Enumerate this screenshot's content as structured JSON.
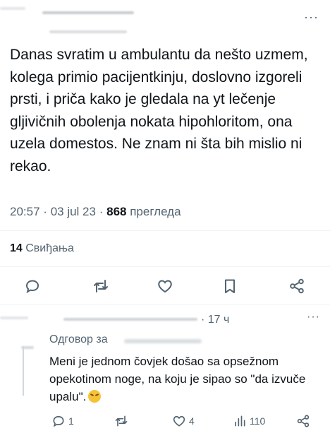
{
  "main_tweet": {
    "text": "Danas svratim u ambulantu da nešto uzmem, kolega primio pacijentkinju, doslovno izgoreli prsti, i priča kako je gledala na yt lečenje gljivičnih obolenja nokata hipohloritom, ona uzela domestos. Ne znam ni šta bih mislio ni rekao.",
    "time": "20:57",
    "date": "03 jul 23",
    "separator": "·",
    "views_count": "868",
    "views_label": "прегледа",
    "likes_count": "14",
    "likes_label": "Свиђања",
    "more_label": "···"
  },
  "actions": {
    "reply": "reply-icon",
    "retweet": "retweet-icon",
    "like": "heart-icon",
    "bookmark": "bookmark-icon",
    "share": "share-icon"
  },
  "reply": {
    "time": "· 17 ч",
    "more_label": "···",
    "replying_to_label": "Одговор за",
    "text": "Meni je jednom čovjek došao sa opsežnom opekotinom noge, na koju je sipao so \"da izvuče upalu\".",
    "reply_count": "1",
    "like_count": "4",
    "views_count": "110"
  },
  "colors": {
    "text": "#0f1419",
    "secondary": "#536471",
    "divider": "#eff3f4",
    "thread_line": "#cfd9de"
  }
}
